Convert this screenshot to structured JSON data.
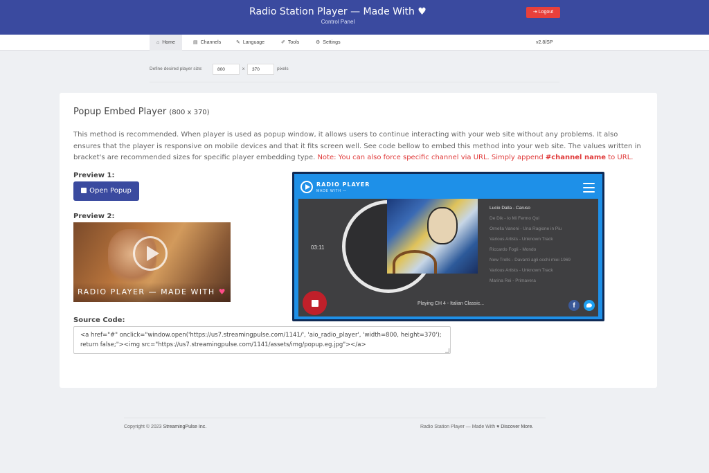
{
  "header": {
    "title": "Radio Station Player — Made With",
    "title_heart": "♥",
    "subtitle": "Control Panel",
    "logout_label": "Logout",
    "logout_icon": "⇥"
  },
  "nav": {
    "items": [
      {
        "icon": "⌂",
        "label": "Home"
      },
      {
        "icon": "▤",
        "label": "Channels"
      },
      {
        "icon": "✎",
        "label": "Language"
      },
      {
        "icon": "✐",
        "label": "Tools"
      },
      {
        "icon": "⚙",
        "label": "Settings"
      }
    ],
    "version": "v2.8/SP"
  },
  "size": {
    "label": "Define desired player size:",
    "width": "800",
    "separator": "x",
    "height": "370",
    "unit": "pixels"
  },
  "card": {
    "title": "Popup Embed Player",
    "title_size": "(800 x 370)",
    "desc_main": "This method is recommended. When player is used as popup window, it allows users to continue interacting with your web site without any problems. It also ensures that the player is responsive on mobile devices and that it fits screen well. See code bellow to embed this method into your web site. The values written in bracket's are recommended sizes for specific player embedding type. ",
    "desc_note": "Note: You can also force specific channel via URL. Simply append ",
    "desc_hash": "#channel name",
    "desc_end": " to URL.",
    "preview1_label": "Preview 1:",
    "open_popup_label": "Open Popup",
    "preview2_label": "Preview 2:",
    "preview2_caption": "RADIO PLAYER — MADE WITH",
    "preview2_heart": "♥",
    "source_label": "Source Code:",
    "source_code": "<a href=\"#\" onclick=\"window.open('https://us7.streamingpulse.com/1141/', 'aio_radio_player', 'width=800, height=370'); return false;\"><img src=\"https://us7.streamingpulse.com/1141/assets/img/popup.eg.jpg\"></a>"
  },
  "player": {
    "brand": "RADIO PLAYER",
    "brand_sub": "MADE WITH —",
    "time": "03:11",
    "tracks": [
      "Lucio Dalla - Caruso",
      "De Dik - Io Mi Fermo Qui",
      "Ornella Vanoni - Una Ragione in Piu",
      "Various Artists - Unknown Track",
      "Riccardo Fogli - Mondo",
      "New Trolls - Davanti agli occhi miei 1969",
      "Various Artists - Unknown Track",
      "Marina Rei - Primavera"
    ],
    "now_playing": "Playing CH 4 - Italian Classic...",
    "facebook_glyph": "f"
  },
  "footer": {
    "copyright_prefix": "Copyright © 2023 ",
    "copyright_company": "StreamingPulse Inc.",
    "right_text": "Radio Station Player — Made With",
    "right_heart": "♥",
    "right_link": "Discover More."
  },
  "colors": {
    "header_bg": "#3a4a9f",
    "logout_bg": "#e8403b",
    "accent_red": "#e03a3a",
    "player_blue": "#1e90e8"
  }
}
